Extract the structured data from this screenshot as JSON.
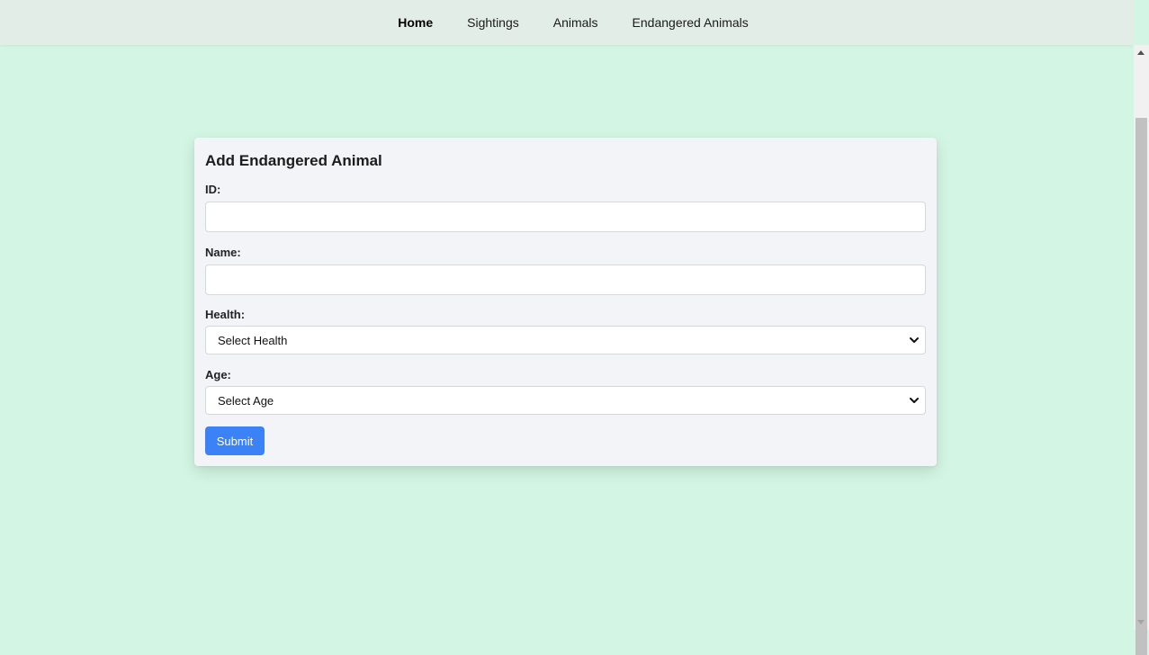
{
  "nav": {
    "items": [
      {
        "label": "Home",
        "active": true
      },
      {
        "label": "Sightings",
        "active": false
      },
      {
        "label": "Animals",
        "active": false
      },
      {
        "label": "Endangered Animals",
        "active": false
      }
    ]
  },
  "form": {
    "title": "Add Endangered Animal",
    "id_label": "ID:",
    "id_value": "",
    "name_label": "Name:",
    "name_value": "",
    "health_label": "Health:",
    "health_selected": "Select Health",
    "age_label": "Age:",
    "age_selected": "Select Age",
    "submit_label": "Submit"
  },
  "icons": {
    "select_arrow": "chevron-down-icon",
    "scroll_up": "arrow-up-icon",
    "scroll_down": "arrow-down-icon"
  },
  "colors": {
    "page_background": "#d3f5e3",
    "navbar_background": "#e3ede8",
    "card_background": "#f3f4f8",
    "submit_button": "#3b82f6"
  }
}
